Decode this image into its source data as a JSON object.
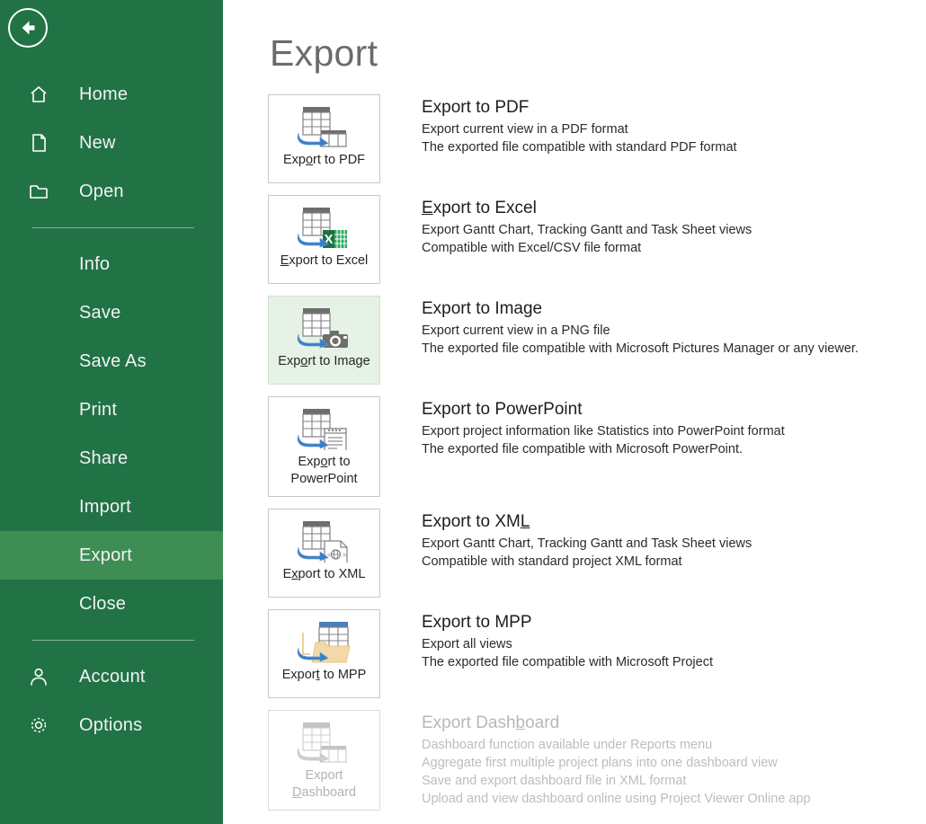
{
  "theme": {
    "sidebar_bg": "#217346",
    "sidebar_selected_bg": "#3e8e54",
    "tile_highlight_bg": "#e5f2e5",
    "title_color": "#6b6b6b",
    "disabled_color": "#b8b8b8",
    "arrow_blue": "#3a7ec4"
  },
  "sidebar": {
    "back_button": "back-arrow",
    "items": [
      {
        "label": "Home",
        "icon": "home-icon",
        "selected": false,
        "has_icon": true
      },
      {
        "label": "New",
        "icon": "page-icon",
        "selected": false,
        "has_icon": true
      },
      {
        "label": "Open",
        "icon": "folder-icon",
        "selected": false,
        "has_icon": true
      },
      {
        "label": "Info",
        "icon": "",
        "selected": false,
        "has_icon": false
      },
      {
        "label": "Save",
        "icon": "",
        "selected": false,
        "has_icon": false
      },
      {
        "label": "Save As",
        "icon": "",
        "selected": false,
        "has_icon": false
      },
      {
        "label": "Print",
        "icon": "",
        "selected": false,
        "has_icon": false
      },
      {
        "label": "Share",
        "icon": "",
        "selected": false,
        "has_icon": false
      },
      {
        "label": "Import",
        "icon": "",
        "selected": false,
        "has_icon": false
      },
      {
        "label": "Export",
        "icon": "",
        "selected": true,
        "has_icon": false
      },
      {
        "label": "Close",
        "icon": "",
        "selected": false,
        "has_icon": false
      },
      {
        "label": "Account",
        "icon": "person-icon",
        "selected": false,
        "has_icon": true
      },
      {
        "label": "Options",
        "icon": "gear-icon",
        "selected": false,
        "has_icon": true
      }
    ]
  },
  "main": {
    "title": "Export",
    "options": [
      {
        "tile_label_pre": "Exp",
        "tile_label_key": "o",
        "tile_label_post": "rt to PDF",
        "tile_label_line2": "",
        "icon": "table-to-table-icon",
        "title_pre": "",
        "title_key": "",
        "title_post": "Export to PDF",
        "lines": [
          "Export current view in a PDF format",
          "The exported file compatible with standard PDF format"
        ],
        "disabled": false,
        "highlight": false
      },
      {
        "tile_label_pre": "",
        "tile_label_key": "E",
        "tile_label_post": "xport to Excel",
        "tile_label_line2": "",
        "icon": "table-to-excel-icon",
        "title_pre": "",
        "title_key": "E",
        "title_post": "xport to Excel",
        "lines": [
          "Export Gantt Chart, Tracking Gantt and Task Sheet views",
          "Compatible with Excel/CSV file format"
        ],
        "disabled": false,
        "highlight": false
      },
      {
        "tile_label_pre": "Exp",
        "tile_label_key": "o",
        "tile_label_post": "rt to Image",
        "tile_label_line2": "",
        "icon": "table-to-camera-icon",
        "title_pre": "",
        "title_key": "",
        "title_post": "Export to Image",
        "lines": [
          "Export current view in a PNG file",
          "The exported file compatible with Microsoft Pictures Manager or any viewer."
        ],
        "disabled": false,
        "highlight": true
      },
      {
        "tile_label_pre": "Exp",
        "tile_label_key": "o",
        "tile_label_post": "rt to",
        "tile_label_line2": "PowerPoint",
        "icon": "table-to-slide-icon",
        "title_pre": "",
        "title_key": "",
        "title_post": "Export to PowerPoint",
        "lines": [
          "Export project information like Statistics into PowerPoint format",
          "The exported file compatible with Microsoft PowerPoint."
        ],
        "disabled": false,
        "highlight": false
      },
      {
        "tile_label_pre": "E",
        "tile_label_key": "x",
        "tile_label_post": "port to XML",
        "tile_label_line2": "",
        "icon": "table-to-xml-icon",
        "title_pre": "Export to XM",
        "title_key": "L",
        "title_post": "",
        "lines": [
          "Export Gantt Chart, Tracking Gantt and Task Sheet views",
          "Compatible with standard project XML format"
        ],
        "disabled": false,
        "highlight": false
      },
      {
        "tile_label_pre": "Expor",
        "tile_label_key": "t",
        "tile_label_post": " to MPP",
        "tile_label_line2": "",
        "icon": "table-to-folder-icon",
        "title_pre": "",
        "title_key": "",
        "title_post": "Export to MPP",
        "lines": [
          "Export all views",
          "The exported file compatible with Microsoft Project"
        ],
        "disabled": false,
        "highlight": false
      },
      {
        "tile_label_pre": "Export",
        "tile_label_key": "",
        "tile_label_post": "",
        "tile_label_line2": "Dashboard",
        "tile_label_line2_key": "D",
        "icon": "table-to-table-icon",
        "title_pre": "Export Dash",
        "title_key": "b",
        "title_post": "oard",
        "lines": [
          "Dashboard function available under Reports menu",
          "Aggregate first multiple project plans into one dashboard view",
          "Save and export dashboard file in XML format",
          "Upload and view dashboard online using Project Viewer Online app"
        ],
        "disabled": true,
        "highlight": false
      }
    ]
  }
}
